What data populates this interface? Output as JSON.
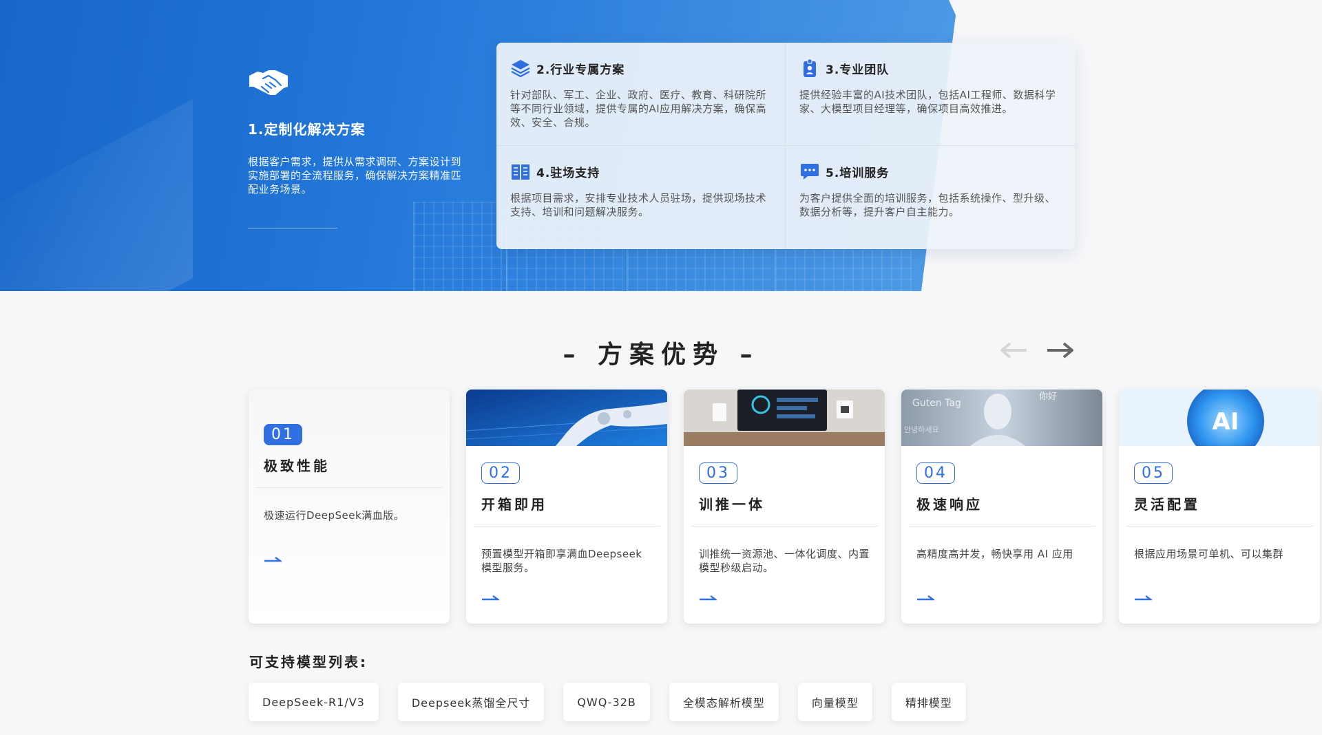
{
  "hero": {
    "custom": {
      "title": "1.定制化解决方案",
      "desc": "根据客户需求，提供从需求调研、方案设计到实施部署的全流程服务，确保解决方案精准匹配业务场景。",
      "icon": "handshake-icon"
    },
    "services": [
      {
        "title": "2.行业专属方案",
        "desc": "针对部队、军工、企业、政府、医疗、教育、科研院所等不同行业领域，提供专属的AI应用解决方案，确保高效、安全、合规。",
        "icon": "layers-icon"
      },
      {
        "title": "3.专业团队",
        "desc": "提供经验丰富的AI技术团队，包括AI工程师、数据科学家、大模型项目经理等，确保项目高效推进。",
        "icon": "id-badge-icon"
      },
      {
        "title": "4.驻场支持",
        "desc": "根据项目需求，安排专业技术人员驻场，提供现场技术支持、培训和问题解决服务。",
        "icon": "book-icon"
      },
      {
        "title": "5.培训服务",
        "desc": "为客户提供全面的培训服务，包括系统操作、型升级、数据分析等，提升客户自主能力。",
        "icon": "chat-bubble-icon"
      }
    ]
  },
  "advantages": {
    "title": "– 方案优势 –",
    "cards": [
      {
        "num": "01",
        "title": "极致性能",
        "desc": "极速运行DeepSeek满血版。"
      },
      {
        "num": "02",
        "title": "开箱即用",
        "desc": "预置模型开箱即享满血Deepseek模型服务。"
      },
      {
        "num": "03",
        "title": "训推一体",
        "desc": "训推统一资源池、一体化调度、内置模型秒级启动。"
      },
      {
        "num": "04",
        "title": "极速响应",
        "desc": "高精度高并发，畅快享用 AI 应用"
      },
      {
        "num": "05",
        "title": "灵活配置",
        "desc": "根据应用场景可单机、可以集群"
      }
    ]
  },
  "models": {
    "title": "可支持模型列表:",
    "chips": [
      "DeepSeek-R1/V3",
      "Deepseek蒸馏全尺寸",
      "QWQ-32B",
      "全模态解析模型",
      "向量模型",
      "精排模型"
    ]
  },
  "colors": {
    "accent": "#2f6fe0",
    "hero_start": "#1766c8",
    "hero_end": "#4f9be6"
  }
}
